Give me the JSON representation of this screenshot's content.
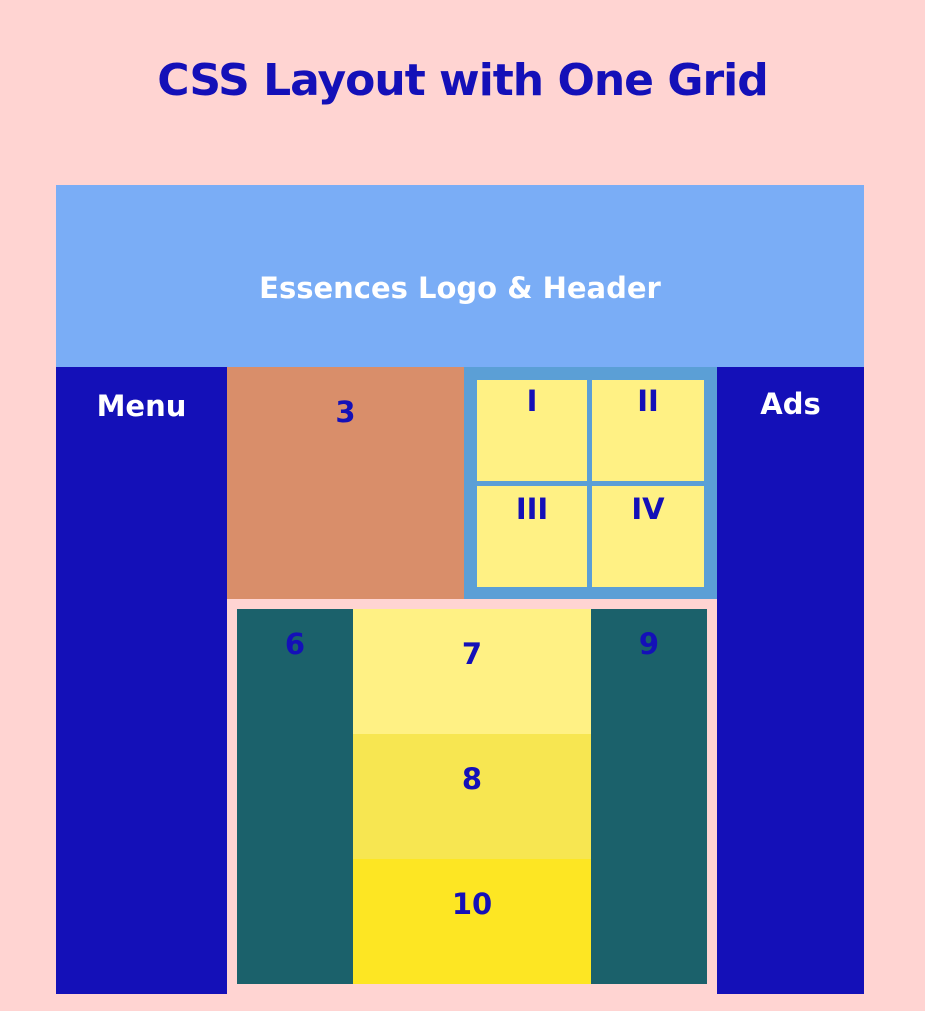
{
  "page": {
    "title": "CSS Layout with One Grid"
  },
  "grid": {
    "header": "Essences Logo & Header",
    "menu": "Menu",
    "ads": "Ads",
    "item3": "3",
    "nested_grid": [
      "I",
      "II",
      "III",
      "IV"
    ],
    "item6": "6",
    "item7": "7",
    "item8": "8",
    "item9": "9",
    "item10": "10"
  },
  "colors": {
    "background": "#ffd4d2",
    "primary_blue": "#1410b8",
    "header_blue": "#7aadf6",
    "terracotta": "#d98e6a",
    "steel_blue": "#5b9fd6",
    "teal": "#1b616b",
    "light_yellow": "#fff184",
    "mid_yellow": "#f7e651",
    "bright_yellow": "#fde623"
  }
}
